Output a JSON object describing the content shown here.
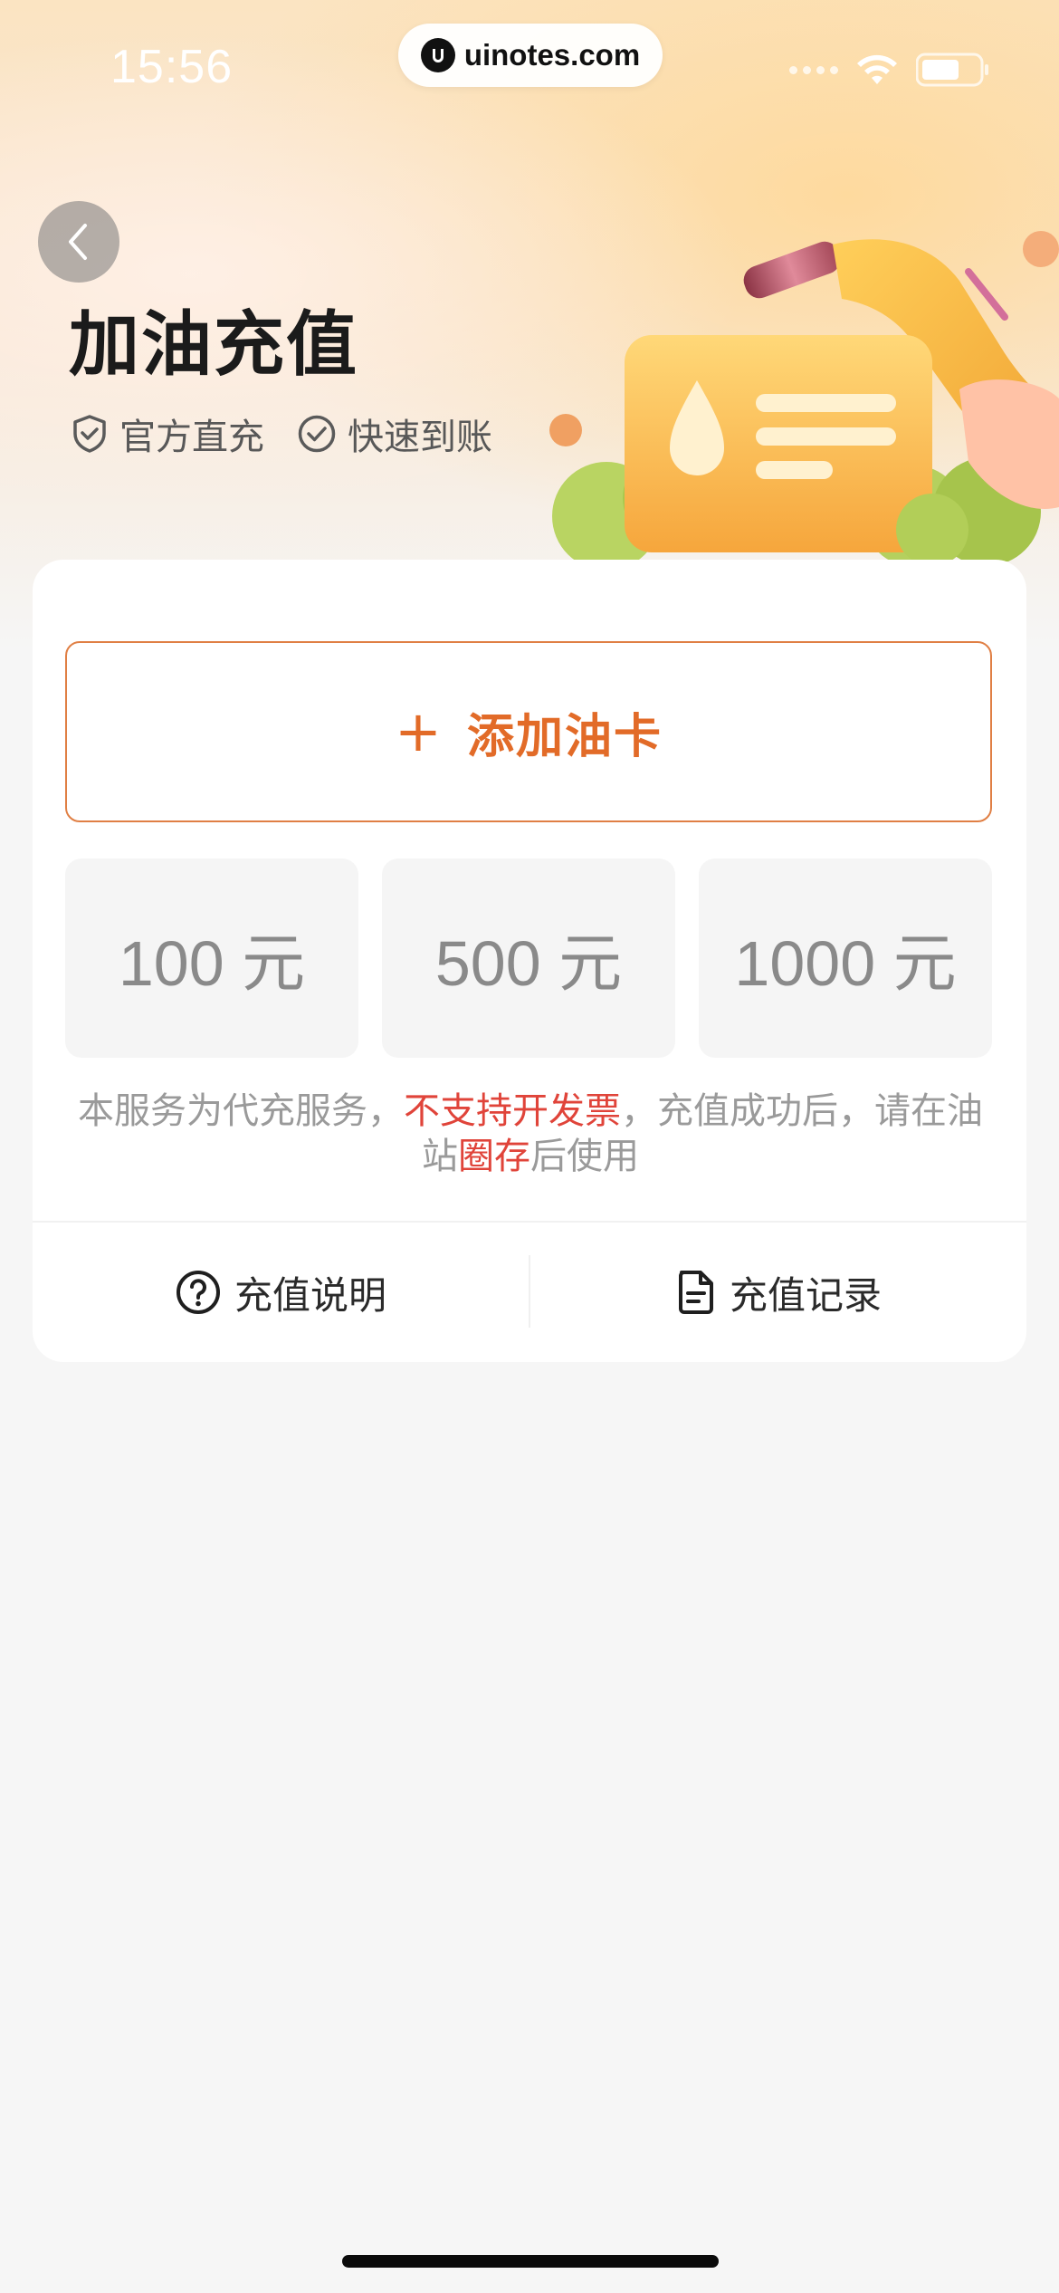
{
  "status_bar": {
    "time": "15:56",
    "url": "uinotes.com"
  },
  "header": {
    "title": "加油充值",
    "badges": [
      {
        "label": "官方直充",
        "icon": "shield-check-icon"
      },
      {
        "label": "快速到账",
        "icon": "check-circle-icon"
      }
    ]
  },
  "card": {
    "add_card_label": "添加油卡",
    "amounts": [
      "100 元",
      "500 元",
      "1000 元"
    ],
    "notice": {
      "part1": "本服务为代充服务，",
      "highlight1": "不支持开发票",
      "part2": "，充值成功后，请在油站",
      "highlight2": "圈存",
      "part3": "后使用"
    },
    "actions": [
      {
        "label": "充值说明",
        "icon": "question-circle-icon"
      },
      {
        "label": "充值记录",
        "icon": "document-icon"
      }
    ]
  },
  "colors": {
    "accent": "#e26b28",
    "highlight": "#e0443a",
    "background": "#f6f6f6"
  }
}
